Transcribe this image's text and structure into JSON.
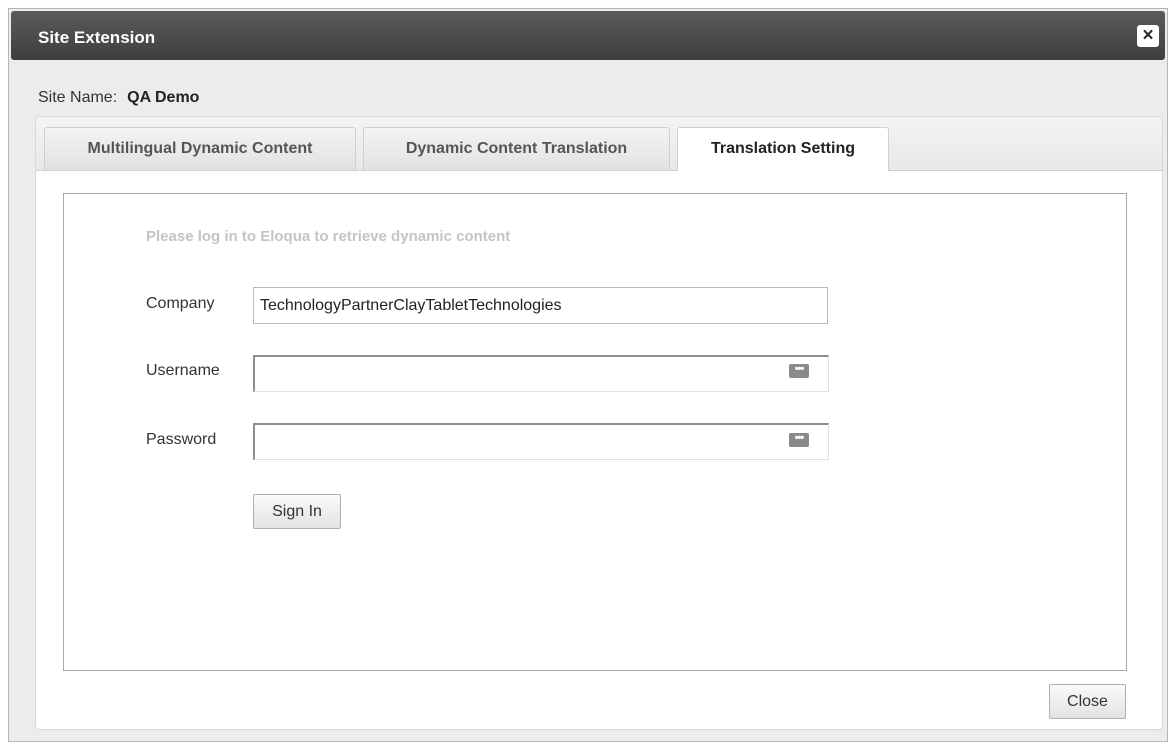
{
  "window": {
    "title": "Site Extension",
    "close_icon": "×"
  },
  "site": {
    "label": "Site Name:",
    "value": "QA Demo"
  },
  "tabs": [
    {
      "label": "Multilingual Dynamic Content",
      "active": false
    },
    {
      "label": "Dynamic Content Translation",
      "active": false
    },
    {
      "label": "Translation Setting",
      "active": true
    }
  ],
  "login": {
    "hint": "Please log in to Eloqua to retrieve dynamic content",
    "company_label": "Company",
    "company_value": "TechnologyPartnerClayTabletTechnologies",
    "username_label": "Username",
    "username_value": "",
    "password_label": "Password",
    "password_value": "",
    "key_icon": "•••",
    "signin_label": "Sign In"
  },
  "footer": {
    "close_label": "Close"
  }
}
